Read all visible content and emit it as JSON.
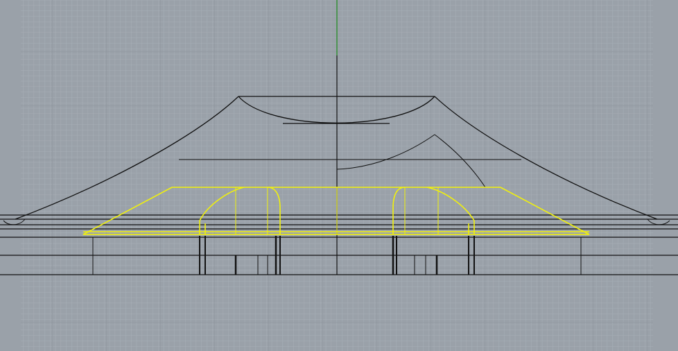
{
  "viewport": {
    "view": "front-orthographic",
    "background_color": "#9aa1a9",
    "minor_grid_color": "#a7aeb5",
    "major_grid_color": "#8c939b",
    "y_axis_color": "#1a8a1a",
    "curve_color": "#111111",
    "selected_color": "#f2f20a"
  }
}
